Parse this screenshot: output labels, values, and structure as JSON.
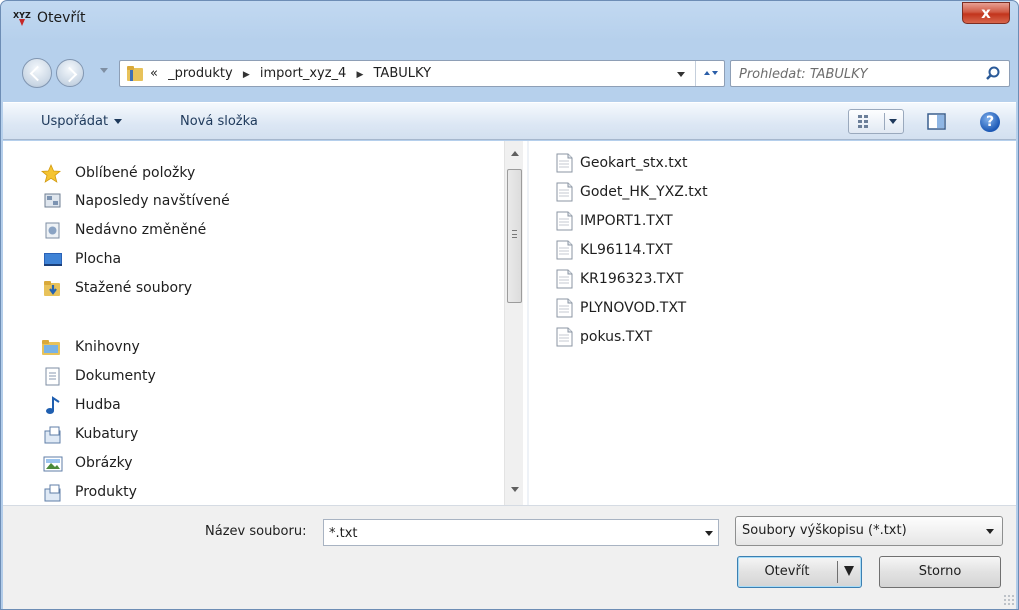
{
  "window": {
    "title": "Otevřít",
    "close_label": "x"
  },
  "address_bar": {
    "crumbs": [
      "«",
      "_produkty",
      "▶",
      "import_xyz_4",
      "▶",
      "TABULKY"
    ],
    "search_placeholder": "Prohledat: TABULKY"
  },
  "toolbar": {
    "organize_label": "Uspořádat",
    "new_folder_label": "Nová složka",
    "help_label": "?"
  },
  "nav_pane": {
    "favorites": {
      "label": "Oblíbené položky",
      "items": [
        {
          "label": "Naposledy navštívené",
          "icon": "recent-places-icon"
        },
        {
          "label": "Nedávno změněné",
          "icon": "recent-changes-icon"
        },
        {
          "label": "Plocha",
          "icon": "desktop-icon"
        },
        {
          "label": "Stažené soubory",
          "icon": "downloads-icon"
        }
      ]
    },
    "libraries": {
      "label": "Knihovny",
      "items": [
        {
          "label": "Dokumenty",
          "icon": "documents-icon"
        },
        {
          "label": "Hudba",
          "icon": "music-icon"
        },
        {
          "label": "Kubatury",
          "icon": "library-icon"
        },
        {
          "label": "Obrázky",
          "icon": "pictures-icon"
        },
        {
          "label": "Produkty",
          "icon": "library-icon"
        }
      ]
    }
  },
  "files": [
    "Geokart_stx.txt",
    "Godet_HK_YXZ.txt",
    "IMPORT1.TXT",
    "KL96114.TXT",
    "KR196323.TXT",
    "PLYNOVOD.TXT",
    "pokus.TXT"
  ],
  "footer": {
    "filename_label": "Název souboru:",
    "filename_value": "*.txt",
    "filter_value": "Soubory výškopisu (*.txt)",
    "open_label": "Otevřít",
    "cancel_label": "Storno"
  },
  "colors": {
    "accent": "#1e395b",
    "close": "#c2341c",
    "title_bg": "#b6d0ec"
  }
}
